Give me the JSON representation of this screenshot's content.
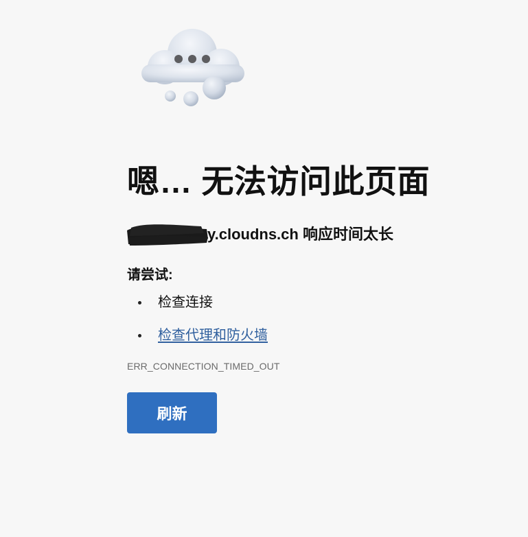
{
  "error_page": {
    "illustration": "cloud-with-dots-icon",
    "title": "嗯… 无法访问此页面",
    "subtitle": {
      "host_suffix": "y.cloudns.ch",
      "message": " 响应时间太长"
    },
    "try_heading": "请尝试:",
    "suggestions": [
      {
        "label": "检查连接",
        "is_link": false
      },
      {
        "label": "检查代理和防火墙",
        "is_link": true
      }
    ],
    "error_code": "ERR_CONNECTION_TIMED_OUT",
    "refresh_label": "刷新"
  },
  "colors": {
    "background": "#f7f7f7",
    "link": "#2f5f9e",
    "button": "#2f6fc0",
    "error_code": "#6a6a6a"
  }
}
